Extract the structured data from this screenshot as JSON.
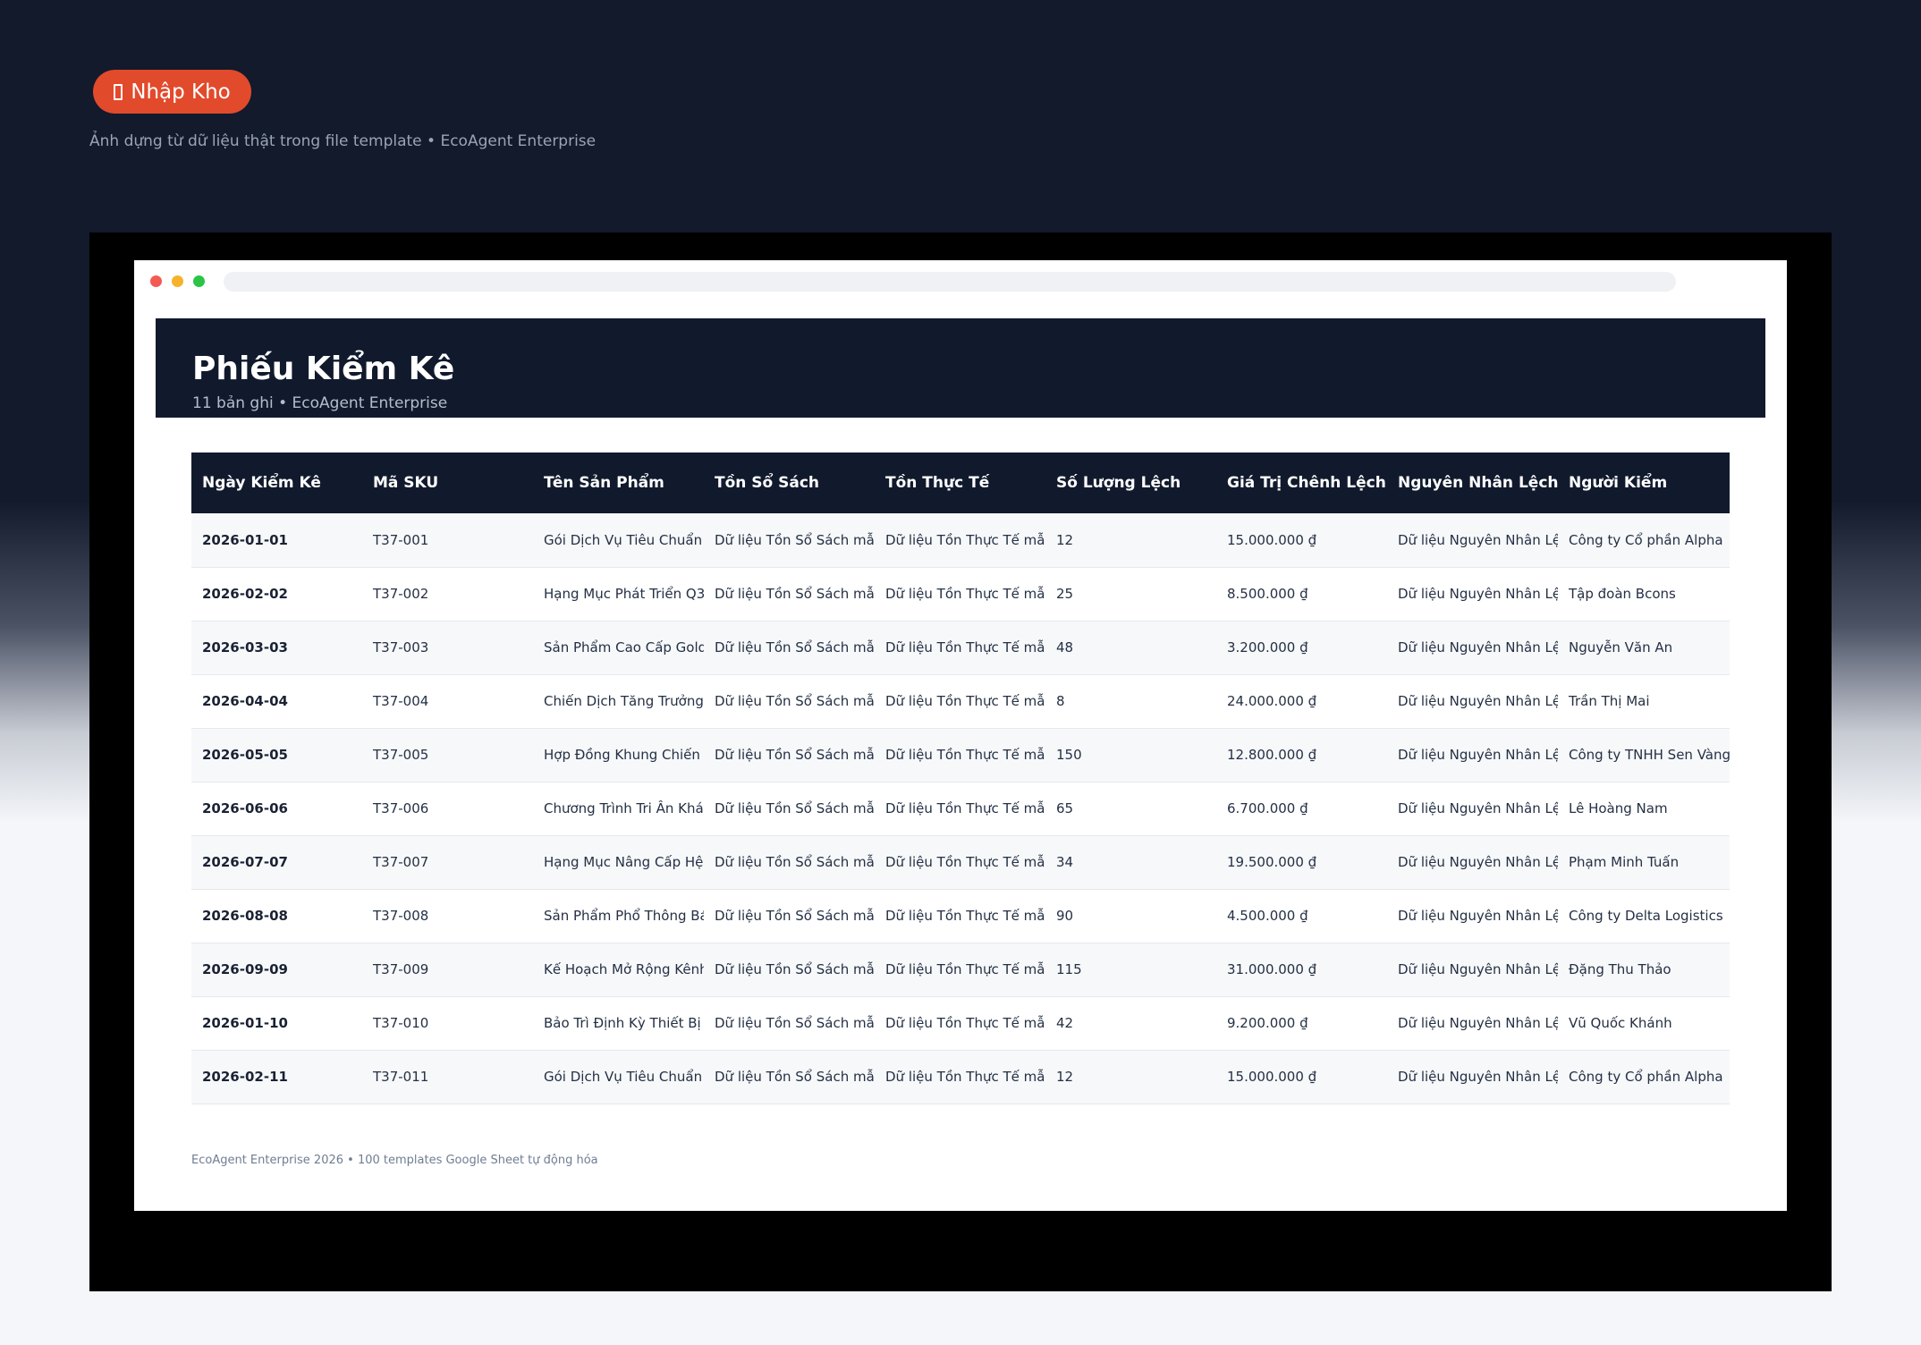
{
  "badge": {
    "label": "Nhập Kho",
    "icon": "clipboard-icon"
  },
  "subtitle": "Ảnh dựng từ dữ liệu thật trong file template • EcoAgent Enterprise",
  "report": {
    "title": "Phiếu Kiểm Kê",
    "meta": "11 bản ghi • EcoAgent Enterprise"
  },
  "table": {
    "columns": [
      "Ngày Kiểm Kê",
      "Mã SKU",
      "Tên Sản Phẩm",
      "Tồn Sổ Sách",
      "Tồn Thực Tế",
      "Số Lượng Lệch",
      "Giá Trị Chênh Lệch",
      "Nguyên Nhân Lệch",
      "Người Kiểm"
    ],
    "rows": [
      [
        "2026-01-01",
        "T37-001",
        "Gói Dịch Vụ Tiêu Chuẩn",
        "Dữ liệu Tồn Sổ Sách mẫu",
        "Dữ liệu Tồn Thực Tế mẫu",
        "12",
        "15.000.000 ₫",
        "Dữ liệu Nguyên Nhân Lệch",
        "Công ty Cổ phần Alpha"
      ],
      [
        "2026-02-02",
        "T37-002",
        "Hạng Mục Phát Triển Q3",
        "Dữ liệu Tồn Sổ Sách mẫu",
        "Dữ liệu Tồn Thực Tế mẫu",
        "25",
        "8.500.000 ₫",
        "Dữ liệu Nguyên Nhân Lệch",
        "Tập đoàn Bcons"
      ],
      [
        "2026-03-03",
        "T37-003",
        "Sản Phẩm Cao Cấp Gold",
        "Dữ liệu Tồn Sổ Sách mẫu",
        "Dữ liệu Tồn Thực Tế mẫu",
        "48",
        "3.200.000 ₫",
        "Dữ liệu Nguyên Nhân Lệch",
        "Nguyễn Văn An"
      ],
      [
        "2026-04-04",
        "T37-004",
        "Chiến Dịch Tăng Trưởng T",
        "Dữ liệu Tồn Sổ Sách mẫu",
        "Dữ liệu Tồn Thực Tế mẫu",
        "8",
        "24.000.000 ₫",
        "Dữ liệu Nguyên Nhân Lệch",
        "Trần Thị Mai"
      ],
      [
        "2026-05-05",
        "T37-005",
        "Hợp Đồng Khung Chiến Lược",
        "Dữ liệu Tồn Sổ Sách mẫu",
        "Dữ liệu Tồn Thực Tế mẫu",
        "150",
        "12.800.000 ₫",
        "Dữ liệu Nguyên Nhân Lệch",
        "Công ty TNHH Sen Vàng"
      ],
      [
        "2026-06-06",
        "T37-006",
        "Chương Trình Tri Ân Khác",
        "Dữ liệu Tồn Sổ Sách mẫu",
        "Dữ liệu Tồn Thực Tế mẫu",
        "65",
        "6.700.000 ₫",
        "Dữ liệu Nguyên Nhân Lệch",
        "Lê Hoàng Nam"
      ],
      [
        "2026-07-07",
        "T37-007",
        "Hạng Mục Nâng Cấp Hệ Thống",
        "Dữ liệu Tồn Sổ Sách mẫu",
        "Dữ liệu Tồn Thực Tế mẫu",
        "34",
        "19.500.000 ₫",
        "Dữ liệu Nguyên Nhân Lệch",
        "Phạm Minh Tuấn"
      ],
      [
        "2026-08-08",
        "T37-008",
        "Sản Phẩm Phổ Thông Bán Chạy",
        "Dữ liệu Tồn Sổ Sách mẫu",
        "Dữ liệu Tồn Thực Tế mẫu",
        "90",
        "4.500.000 ₫",
        "Dữ liệu Nguyên Nhân Lệch",
        "Công ty Delta Logistics"
      ],
      [
        "2026-09-09",
        "T37-009",
        "Kế Hoạch Mở Rộng Kênh Phân Phối",
        "Dữ liệu Tồn Sổ Sách mẫu",
        "Dữ liệu Tồn Thực Tế mẫu",
        "115",
        "31.000.000 ₫",
        "Dữ liệu Nguyên Nhân Lệch",
        "Đặng Thu Thảo"
      ],
      [
        "2026-01-10",
        "T37-010",
        "Bảo Trì Định Kỳ Thiết Bị",
        "Dữ liệu Tồn Sổ Sách mẫu",
        "Dữ liệu Tồn Thực Tế mẫu",
        "42",
        "9.200.000 ₫",
        "Dữ liệu Nguyên Nhân Lệch",
        "Vũ Quốc Khánh"
      ],
      [
        "2026-02-11",
        "T37-011",
        "Gói Dịch Vụ Tiêu Chuẩn",
        "Dữ liệu Tồn Sổ Sách mẫu",
        "Dữ liệu Tồn Thực Tế mẫu",
        "12",
        "15.000.000 ₫",
        "Dữ liệu Nguyên Nhân Lệch",
        "Công ty Cổ phần Alpha"
      ]
    ]
  },
  "footer": "EcoAgent Enterprise 2026 • 100 templates Google Sheet tự động hóa",
  "colors": {
    "background": "#121a2c",
    "accent": "#e24a2c",
    "header": "#111a2d"
  }
}
